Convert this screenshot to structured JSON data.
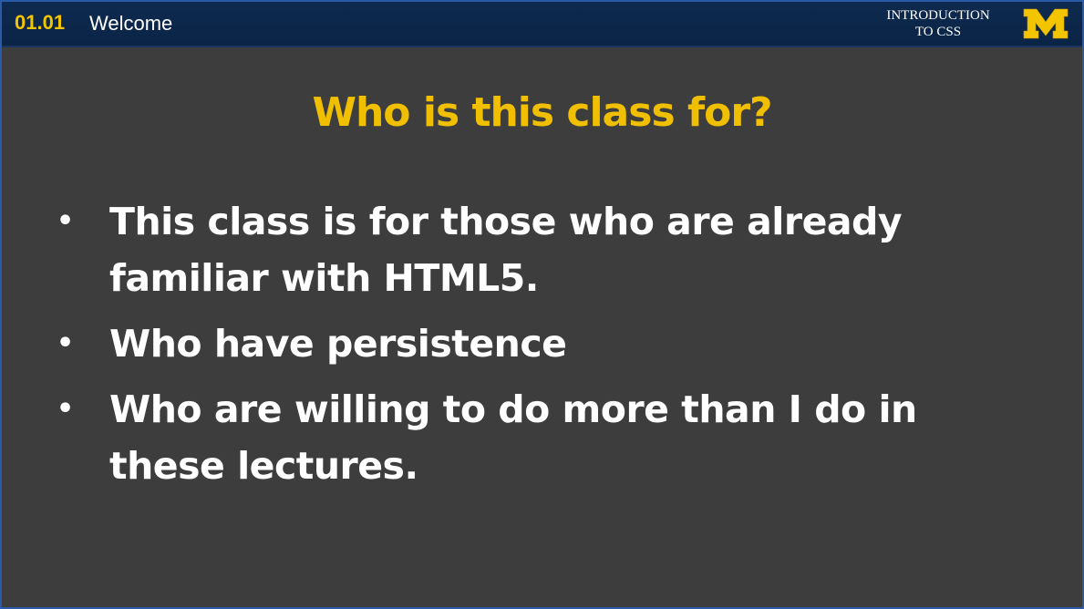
{
  "header": {
    "lesson_number": "01.01",
    "lesson_title": "Welcome",
    "course_line1": "INTRODUCTION",
    "course_line2": "TO CSS",
    "logo_letter": "M",
    "logo_icon": "university-m-logo-icon"
  },
  "slide": {
    "title": "Who is this class for?",
    "bullets": [
      "This class is for those who are already familiar with HTML5.",
      "Who have persistence",
      "Who are willing to do more than I do in these lectures."
    ]
  },
  "colors": {
    "background": "#3d3d3d",
    "header": "#0e2a4f",
    "accent_yellow": "#f0c000",
    "text": "#ffffff"
  }
}
